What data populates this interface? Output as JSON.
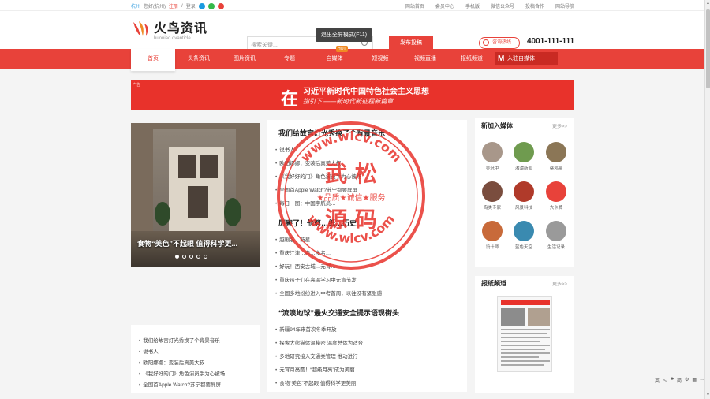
{
  "topbar": {
    "city": "杭州",
    "location": "您好(杭州)",
    "register": "注册",
    "login": "登录",
    "right_links": [
      "网站首页",
      "会员中心",
      "手机版",
      "微信公众号",
      "投稿合作",
      "网站导航"
    ]
  },
  "header": {
    "logo_cn": "火鸟资讯",
    "logo_en": "huoniao.ovanticle",
    "search_placeholder": "搜索关键...",
    "publish_label": "发布投稿",
    "tooltip": "退出全屏模式(F11)",
    "service_label": "咨询热线",
    "phone": "4001-111-111"
  },
  "nav": {
    "items": [
      "首页",
      "头条资讯",
      "图片资讯",
      "专题",
      "自媒体",
      "短视频",
      "视频直播",
      "报纸频道"
    ],
    "hot_badge": "HOT",
    "join_label": "入驻自媒体",
    "join_mark": "M"
  },
  "banner": {
    "tag": "广告",
    "big_char": "在",
    "title": "习近平新时代中国特色社会主义思想",
    "subtitle": "指引下 ——新时代新征程新篇章"
  },
  "slider": {
    "caption": "食物“美色”不起眼 值得科学更...",
    "dot_count": 5
  },
  "main": {
    "sections": [
      {
        "headline": "我们给故宫灯光秀换了个背景音乐",
        "items": [
          "说书人",
          "欧阳娜娜：变装后真美大叔",
          "《我好好的门》角色演员手为心被场",
          "全国首Apple Watch?苏宁都要屏屏",
          "每日一图：中国宇航员…"
        ]
      },
      {
        "headline": "厉害了！他剪…纸…历史",
        "items": [
          "越剧名…新星…",
          "重庆江津…白…多名…",
          "好玩！西安古城…元宵…",
          "重庆孩子们在高温学习中元宵节发",
          "全国多地纷纷进入中考首周，以往没有紧张感"
        ]
      },
      {
        "headline": "“流浪地球”最火交通安全提示语现街头",
        "items": [
          "新疆94年来首次冬季开放",
          "探索大熊猫体温秘密 温度总体为适合",
          "多地研究接入交通类管理 推动进行",
          "元宵月亮圆！“超级月亮”成为美丽",
          "食物“美色”不起眼 值得科学更美丽"
        ]
      }
    ]
  },
  "left_list": {
    "items": [
      "我们给故宫灯光秀换了个背景音乐",
      "说书人",
      "欧阳娜娜：变装后真美大叔",
      "《我好好的门》角色演员手为心被场",
      "全国首Apple Watch?苏宁都要屏屏"
    ]
  },
  "media_panel": {
    "title": "新加入媒体",
    "more": "更多>>",
    "items": [
      {
        "name": "吴冠中",
        "color": "#a8978a"
      },
      {
        "name": "湘潭新闻",
        "color": "#6f9b4f"
      },
      {
        "name": "蔡鸿泉",
        "color": "#8b7656"
      },
      {
        "name": "鸟类专家",
        "color": "#7a4d3e"
      },
      {
        "name": "风景科技",
        "color": "#b03a2a"
      },
      {
        "name": "大卡牌",
        "color": "#e8423a"
      },
      {
        "name": "设计师",
        "color": "#c86a3a"
      },
      {
        "name": "蓝色天空",
        "color": "#3a8ab0"
      },
      {
        "name": "生活记录",
        "color": "#9a9a9a"
      }
    ]
  },
  "paper_panel": {
    "title": "报纸频道",
    "more": "更多>>"
  },
  "watermark": {
    "top_arc": "www.wlcv.com",
    "line1": "武 松",
    "line2": "源 码",
    "middle": "★品质★诚信★服务",
    "bottom_arc": "www.wlcv.com"
  },
  "tray": [
    "英",
    "〜",
    "♣",
    "简",
    "⚙",
    "▦",
    "…"
  ]
}
